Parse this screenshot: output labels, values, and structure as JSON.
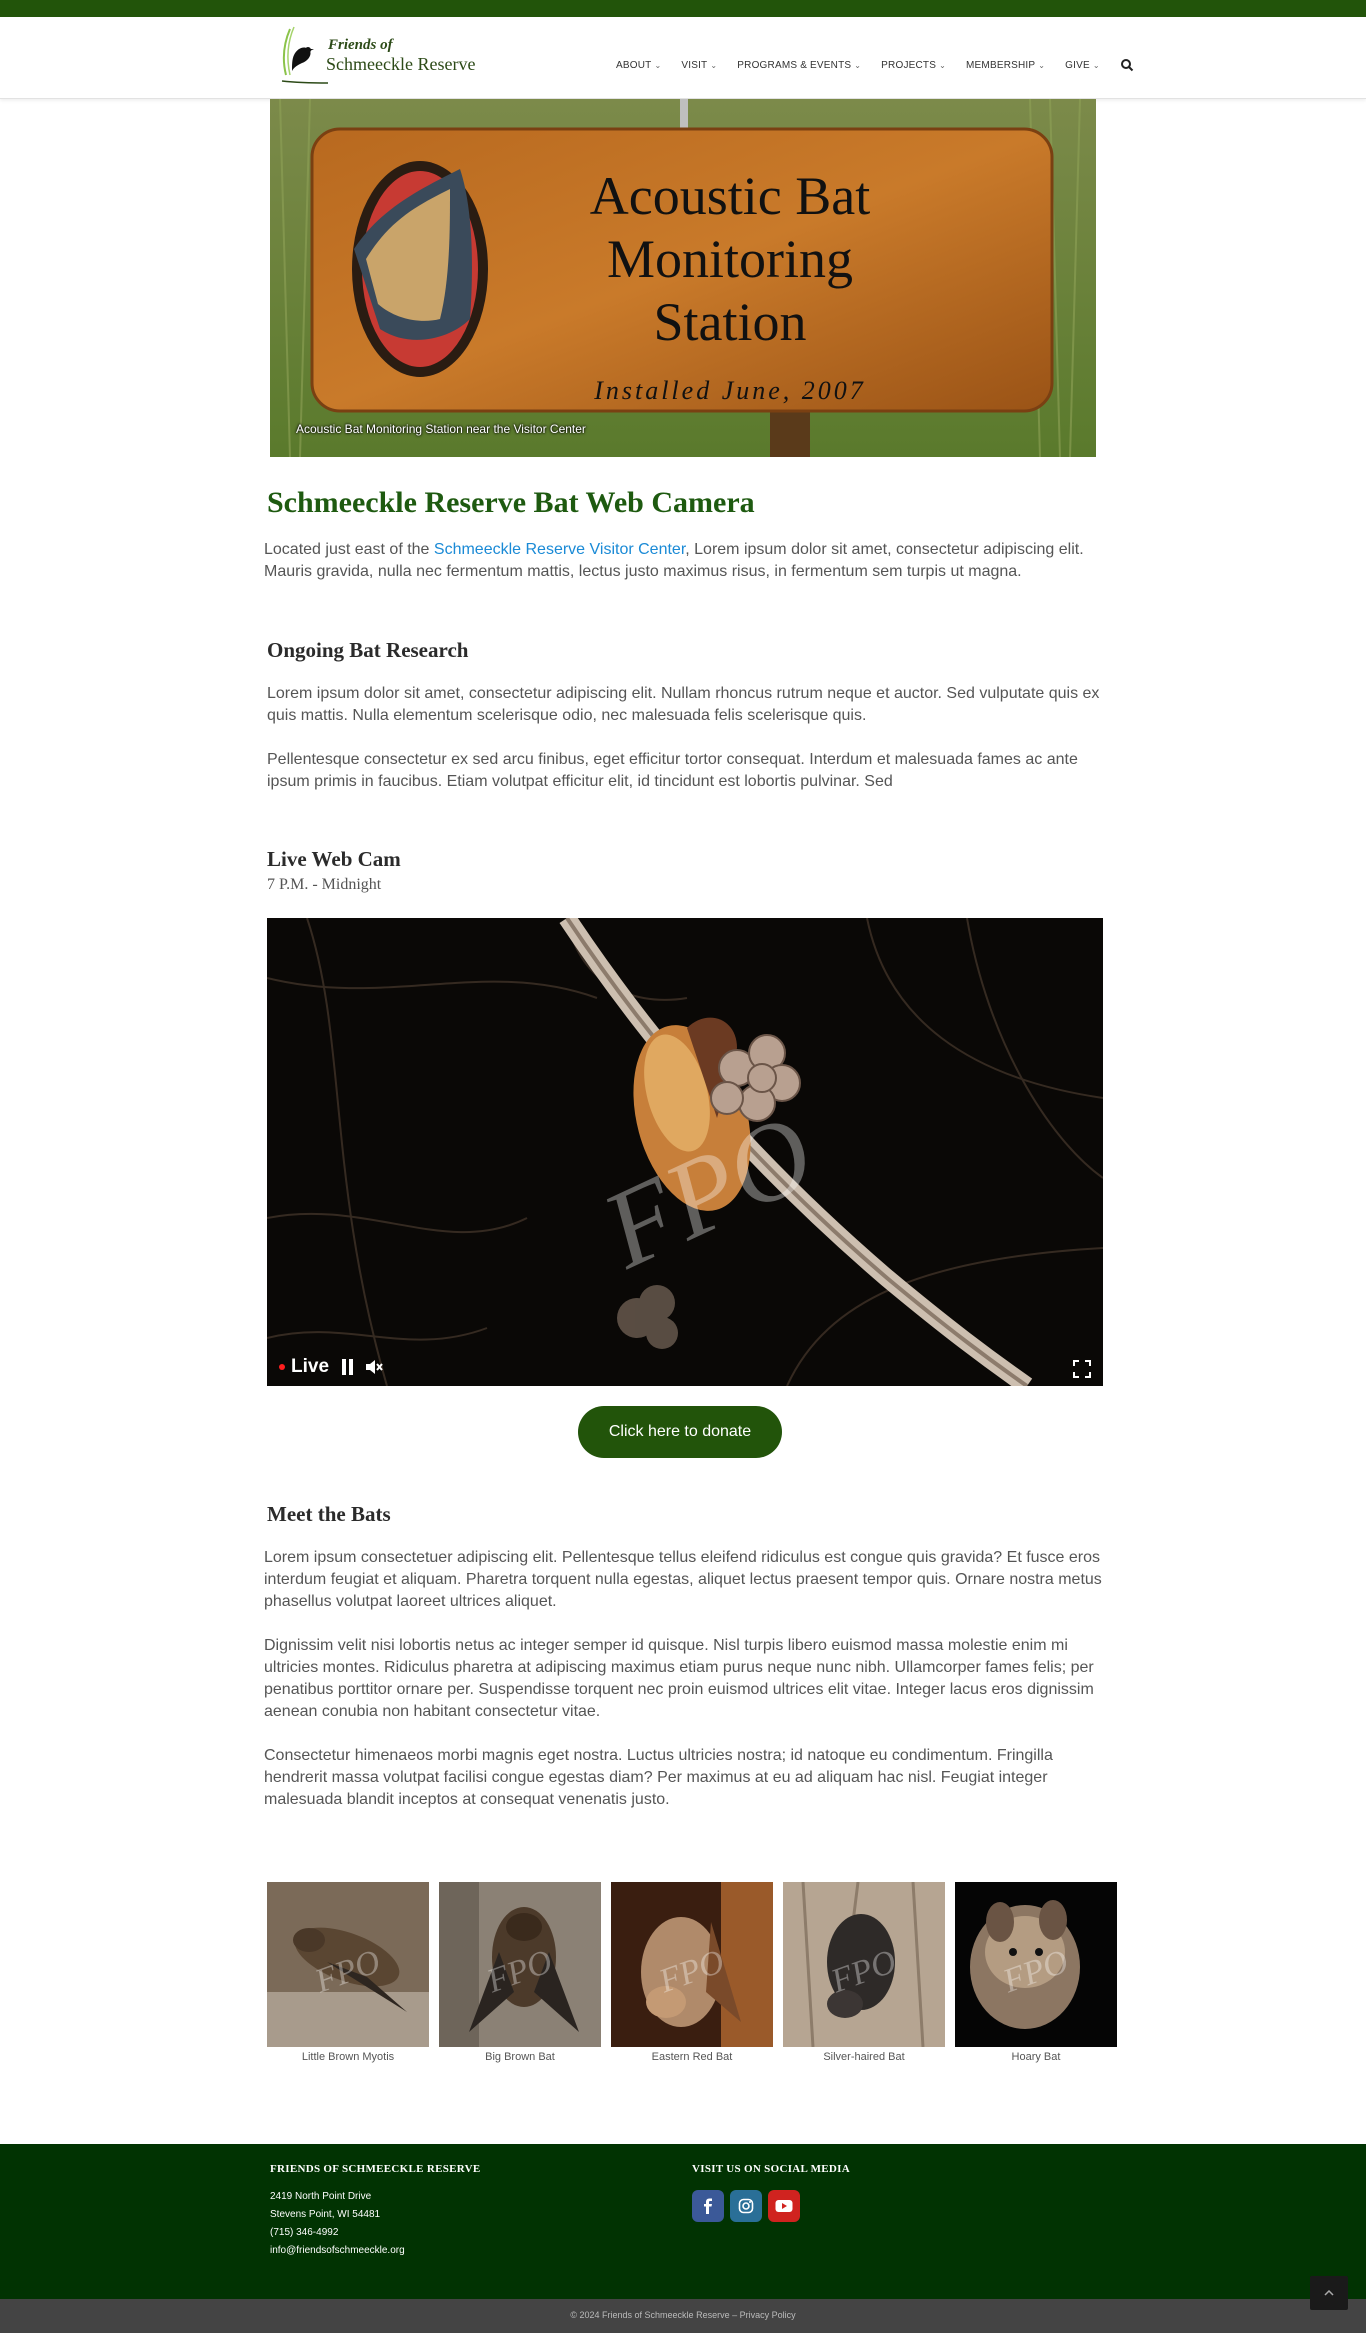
{
  "colors": {
    "brand_green": "#22540a",
    "heading_green": "#1e5a10",
    "link_blue": "#1a8ad6",
    "footer_bg": "#013302",
    "bottom_bar": "#444444"
  },
  "logo": {
    "line1": "Friends of",
    "line2": "Schmeeckle Reserve"
  },
  "nav": {
    "items": [
      {
        "label": "ABOUT"
      },
      {
        "label": "VISIT"
      },
      {
        "label": "PROGRAMS & EVENTS"
      },
      {
        "label": "PROJECTS"
      },
      {
        "label": "MEMBERSHIP"
      },
      {
        "label": "GIVE"
      }
    ],
    "search_icon": "search-icon"
  },
  "hero": {
    "sign_lines": [
      "Acoustic Bat",
      "Monitoring",
      "Station"
    ],
    "sign_sub": "Installed June, 2007",
    "caption": "Acoustic Bat Monitoring Station near the Visitor Center"
  },
  "page_title": "Schmeeckle Reserve Bat Web Camera",
  "intro": {
    "prefix": "Located just east of the ",
    "link": "Schmeeckle Reserve Visitor Center",
    "suffix": ", Lorem ipsum dolor sit amet, consectetur adipiscing elit. Mauris gravida, nulla nec fermentum mattis, lectus justo maximus risus, in fermentum sem turpis ut magna."
  },
  "research": {
    "heading": "Ongoing Bat Research",
    "p1": "Lorem ipsum dolor sit amet, consectetur adipiscing elit. Nullam rhoncus rutrum neque et auctor. Sed vulputate quis ex quis mattis. Nulla elementum scelerisque odio, nec malesuada felis scelerisque quis.",
    "p2": "Pellentesque consectetur ex sed arcu finibus, eget efficitur tortor consequat. Interdum et malesuada fames ac ante ipsum primis in faucibus. Etiam volutpat efficitur elit, id tincidunt est lobortis pulvinar. Sed"
  },
  "webcam": {
    "heading": "Live Web Cam",
    "hours": "7 P.M. - Midnight",
    "watermark": "FPO",
    "live_label": "Live"
  },
  "donate_label": "Click here to donate",
  "meet": {
    "heading": "Meet the Bats",
    "p1": "Lorem ipsum consectetuer adipiscing elit. Pellentesque tellus eleifend ridiculus est congue quis gravida? Et fusce eros interdum feugiat et aliquam. Pharetra torquent nulla egestas, aliquet lectus praesent tempor quis. Ornare nostra metus phasellus volutpat laoreet ultrices aliquet.",
    "p2": "Dignissim velit nisi lobortis netus ac integer semper id quisque. Nisl turpis libero euismod massa molestie enim mi ultricies montes. Ridiculus pharetra at adipiscing maximus etiam purus neque nunc nibh. Ullamcorper fames felis; per penatibus porttitor ornare per. Suspendisse torquent nec proin euismod ultrices elit vitae. Integer lacus eros dignissim aenean conubia non habitant consectetur vitae.",
    "p3": "Consectetur himenaeos morbi magnis eget nostra. Luctus ultricies nostra; id natoque eu condimentum. Fringilla hendrerit massa volutpat facilisi congue egestas diam? Per maximus at eu ad aliquam hac nisl. Feugiat integer malesuada blandit inceptos at consequat venenatis justo."
  },
  "bats": [
    {
      "name": "Little Brown Myotis",
      "watermark": "FPO"
    },
    {
      "name": "Big Brown Bat",
      "watermark": "FPO"
    },
    {
      "name": "Eastern Red Bat",
      "watermark": "FPO"
    },
    {
      "name": "Silver-haired Bat",
      "watermark": "FPO"
    },
    {
      "name": "Hoary Bat",
      "watermark": "FPO"
    }
  ],
  "footer": {
    "org_heading": "FRIENDS OF SCHMEECKLE RESERVE",
    "address1": "2419 North Point Drive",
    "address2": "Stevens Point, WI 54481",
    "phone": "(715) 346-4992",
    "email": "info@friendsofschmeeckle.org",
    "social_heading": "VISIT US ON SOCIAL MEDIA",
    "social": [
      "facebook-icon",
      "instagram-icon",
      "youtube-icon"
    ],
    "copyright": "© 2024 Friends of Schmeeckle Reserve – ",
    "privacy": "Privacy Policy"
  }
}
